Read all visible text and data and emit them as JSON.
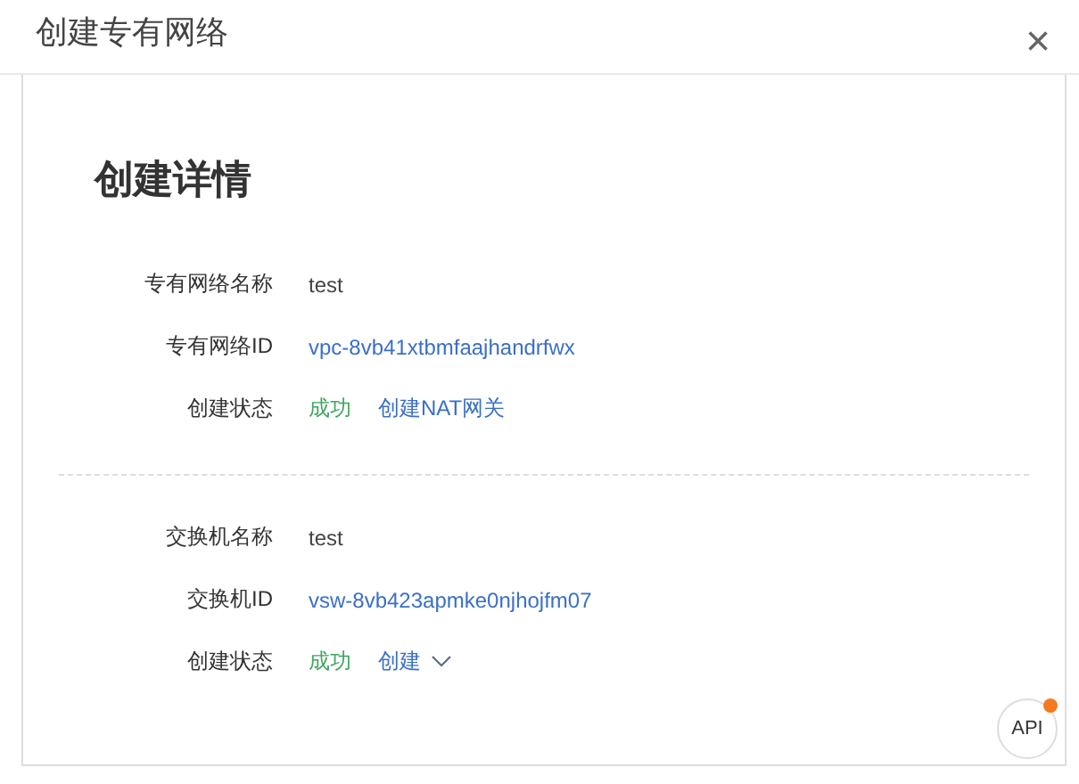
{
  "dialog": {
    "title": "创建专有网络",
    "close": "×"
  },
  "heading": "创建详情",
  "sections": [
    {
      "rows": [
        {
          "label": "专有网络名称",
          "kind": "text",
          "value": "test"
        },
        {
          "label": "专有网络ID",
          "kind": "link",
          "value": "vpc-8vb41xtbmfaajhandrfwx"
        },
        {
          "label": "创建状态",
          "kind": "status",
          "value": "成功",
          "action": "创建NAT网关",
          "dropdown": false
        }
      ]
    },
    {
      "rows": [
        {
          "label": "交换机名称",
          "kind": "text",
          "value": "test"
        },
        {
          "label": "交换机ID",
          "kind": "link",
          "value": "vsw-8vb423apmke0njhojfm07"
        },
        {
          "label": "创建状态",
          "kind": "status",
          "value": "成功",
          "action": "创建",
          "dropdown": true
        }
      ]
    }
  ],
  "api_button": {
    "label": "API",
    "notification": true
  }
}
